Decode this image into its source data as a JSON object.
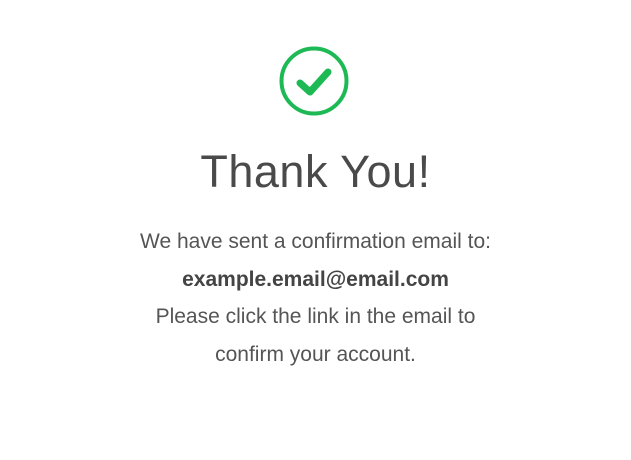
{
  "confirmation": {
    "title": "Thank You!",
    "line1": "We have sent a confirmation email to:",
    "email": "example.email@email.com",
    "line3": "Please click the link in the email to",
    "line4": "confirm your account."
  },
  "icons": {
    "success": "check-circle-icon"
  },
  "colors": {
    "accent": "#1DB954",
    "text": "#4a4a4a"
  }
}
